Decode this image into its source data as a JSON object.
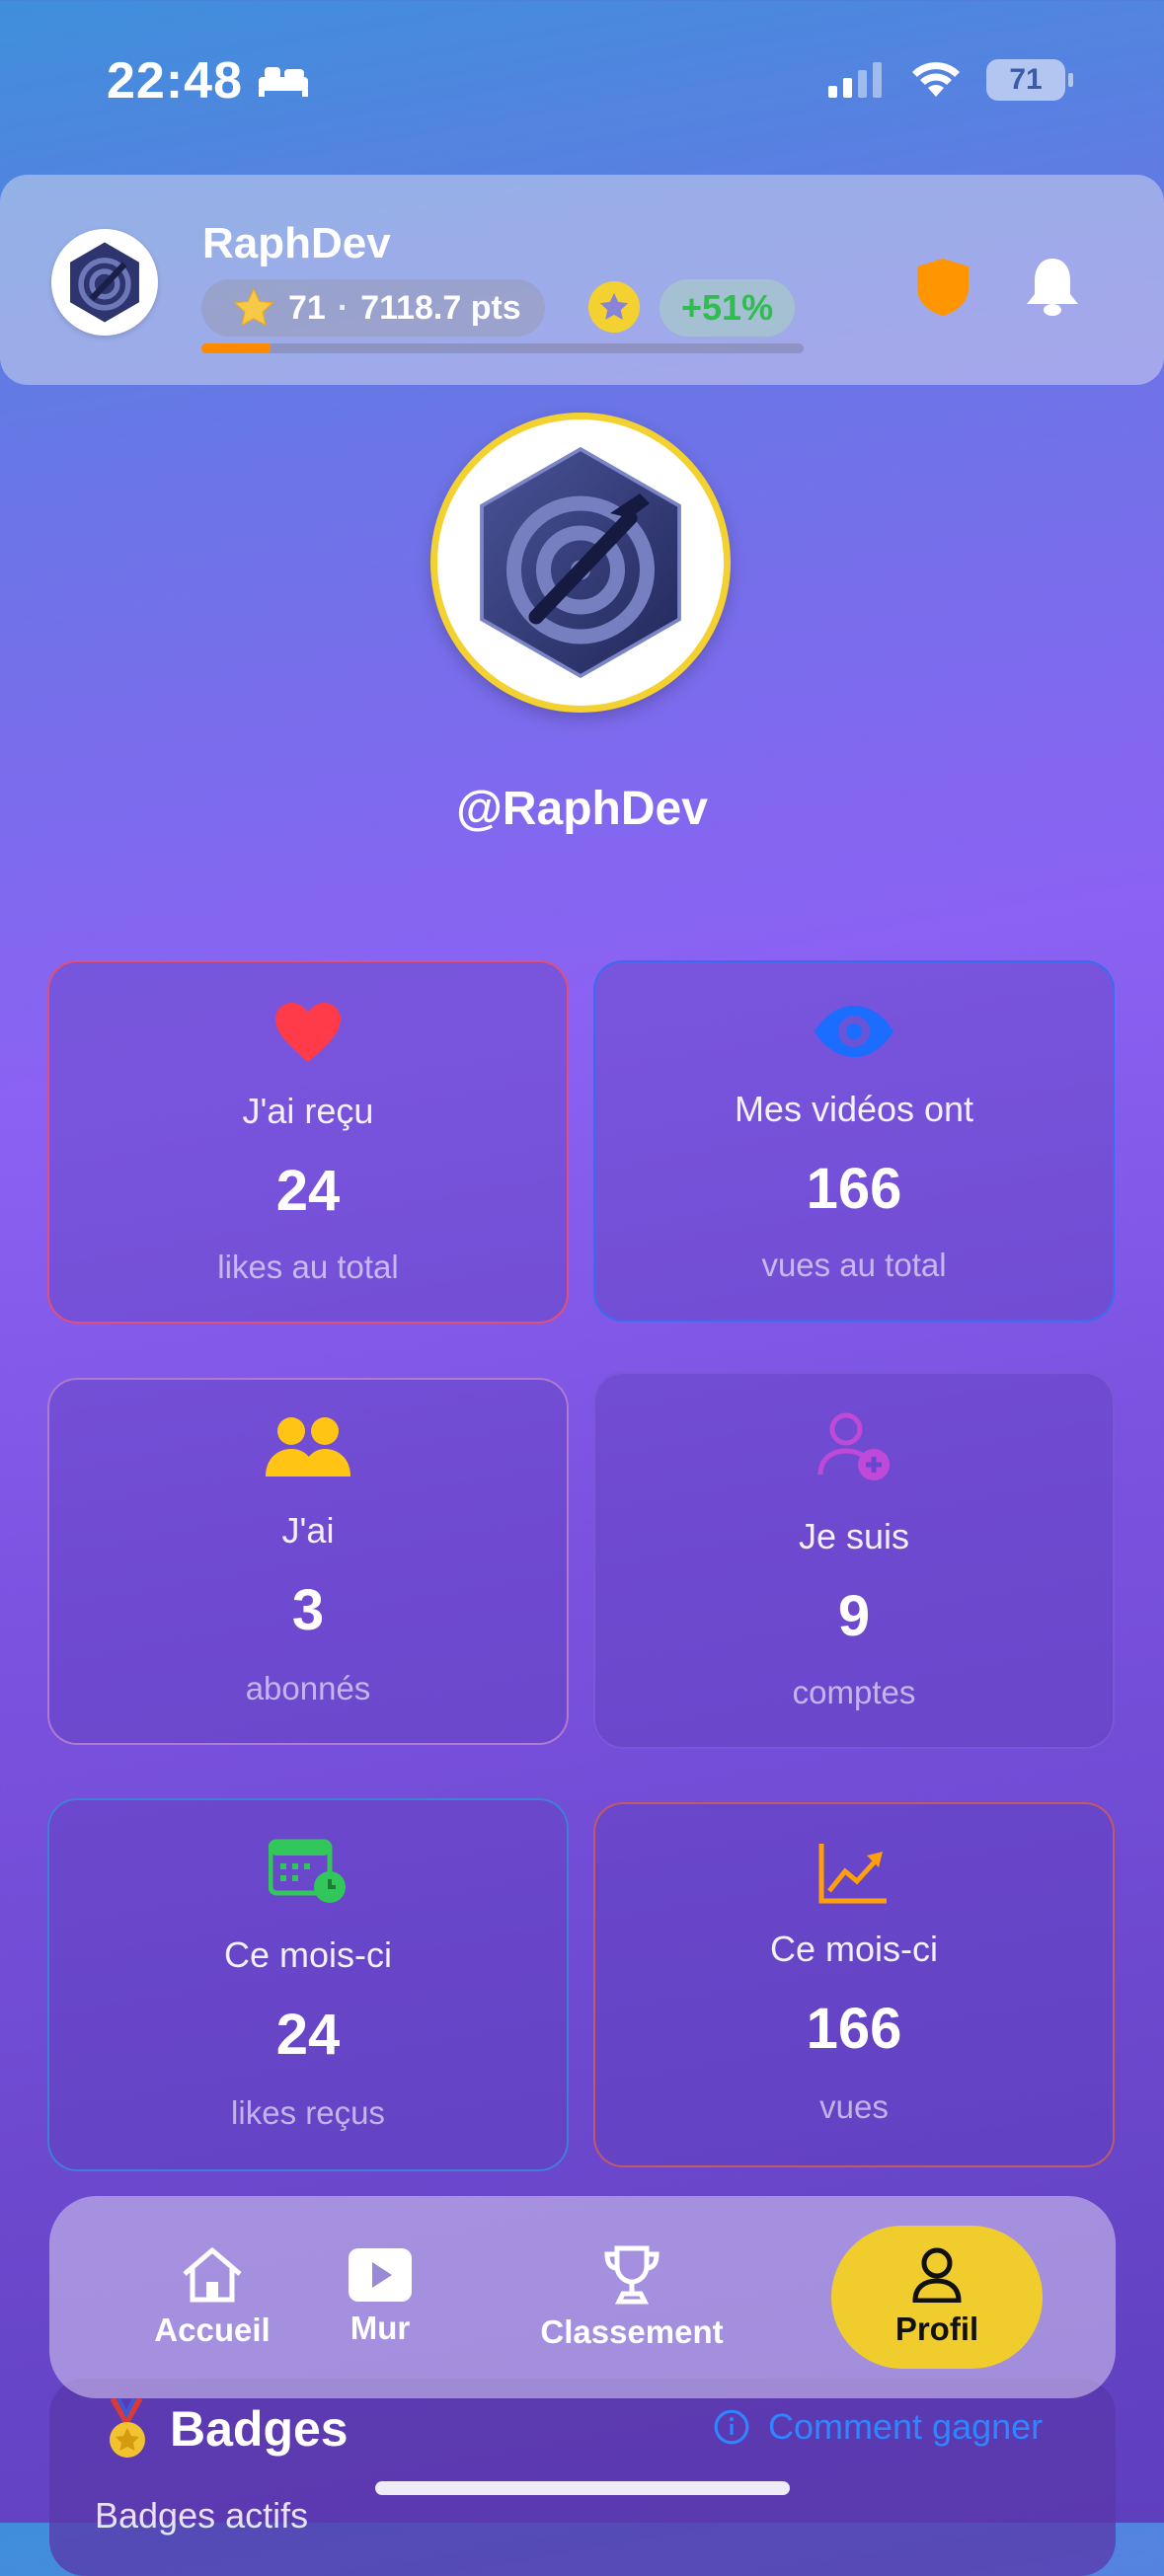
{
  "status_bar": {
    "time": "22:48",
    "battery": "71"
  },
  "header": {
    "username": "RaphDev",
    "level": "71",
    "separator": "·",
    "points": "7118.7 pts",
    "growth": "+51%",
    "progress_fraction": 0.115,
    "colors": {
      "progress": "#ff8a00",
      "growth": "#2fbd4f",
      "shield": "#ff9500"
    }
  },
  "profile": {
    "handle": "@RaphDev"
  },
  "stats": [
    {
      "id": "likes",
      "icon": "heart-icon",
      "label": "J'ai reçu",
      "value": "24",
      "sub": "likes au total",
      "border": "#e0507a"
    },
    {
      "id": "views",
      "icon": "eye-icon",
      "label": "Mes vidéos ont",
      "value": "166",
      "sub": "vues au total",
      "border": "#3a6cf0"
    },
    {
      "id": "followers",
      "icon": "people-icon",
      "label": "J'ai",
      "value": "3",
      "sub": "abonnés",
      "border": "#b07ad0"
    },
    {
      "id": "following",
      "icon": "user-plus-icon",
      "label": "Je suis",
      "value": "9",
      "sub": "comptes",
      "border": "#7a58d8"
    },
    {
      "id": "month-likes",
      "icon": "calendar-icon",
      "label": "Ce mois-ci",
      "value": "24",
      "sub": "likes reçus",
      "border": "#3f7fd8"
    },
    {
      "id": "month-views",
      "icon": "chart-up-icon",
      "label": "Ce mois-ci",
      "value": "166",
      "sub": "vues",
      "border": "#c05a6a"
    }
  ],
  "nav": {
    "items": [
      {
        "label": "Accueil",
        "icon": "home-icon"
      },
      {
        "label": "Mur",
        "icon": "play-icon"
      },
      {
        "label": "Classement",
        "icon": "trophy-icon"
      },
      {
        "label": "Profil",
        "icon": "person-icon",
        "active": true
      }
    ]
  },
  "badges": {
    "title": "Badges",
    "how_to": "Comment gagner",
    "subtitle": "Badges actifs"
  }
}
